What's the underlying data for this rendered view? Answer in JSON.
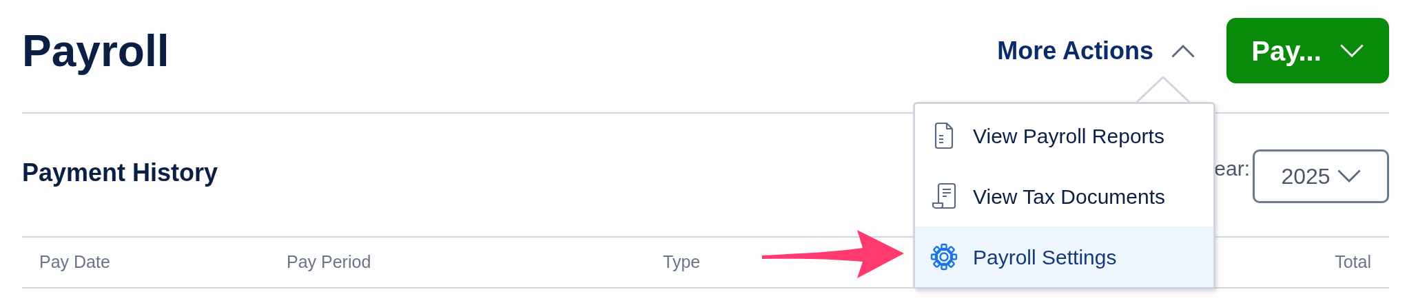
{
  "page": {
    "title": "Payroll"
  },
  "more_actions": {
    "label": "More Actions",
    "expanded": true
  },
  "pay_button": {
    "label": "Pay..."
  },
  "menu": [
    {
      "label": "View Payroll Reports",
      "selected": false
    },
    {
      "label": "View Tax Documents",
      "selected": false
    },
    {
      "label": "Payroll Settings",
      "selected": true
    }
  ],
  "section": {
    "title": "Payment History",
    "year_label": "ear:",
    "year_value": "2025"
  },
  "table": {
    "columns": [
      "Pay Date",
      "Pay Period",
      "Type",
      "Total"
    ]
  }
}
